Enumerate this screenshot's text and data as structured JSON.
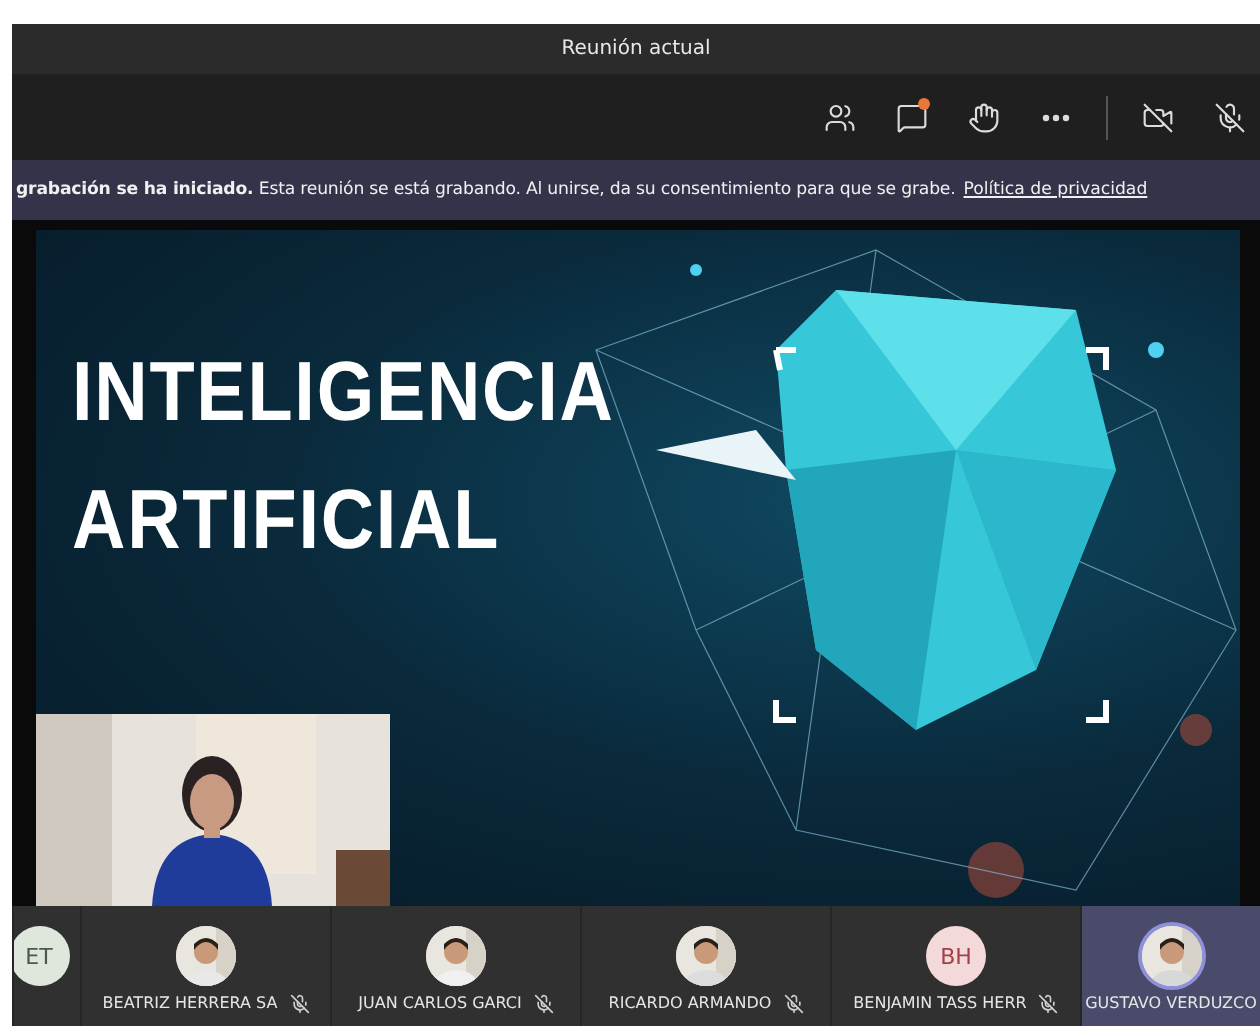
{
  "window": {
    "title": "Reunión actual"
  },
  "toolbar": [
    {
      "kind": "people"
    },
    {
      "kind": "chat",
      "unread": true
    },
    {
      "kind": "hand"
    },
    {
      "kind": "more"
    },
    {
      "kind": "camera-off"
    },
    {
      "kind": "mic-off"
    }
  ],
  "banner": {
    "title": "grabación se ha iniciado.",
    "message": "Esta reunión se está grabando. Al unirse, da su consentimiento para que se grabe.",
    "link": "Política de privacidad"
  },
  "slide": {
    "lines": [
      "INTELIGENCIA",
      "ARTIFICIAL"
    ]
  },
  "participants": [
    {
      "kind": "initials",
      "initials": "ET",
      "speaking": false
    },
    {
      "name": "BEATRIZ HERRERA SA",
      "muted": true,
      "speaking": false
    },
    {
      "name": "JUAN CARLOS GARCI",
      "muted": true,
      "speaking": false
    },
    {
      "name": "RICARDO ARMANDO",
      "muted": true,
      "speaking": false
    },
    {
      "kind": "initials",
      "initials": "BH",
      "name": "BENJAMIN TASS HERR",
      "muted": true,
      "speaking": false
    },
    {
      "name": "GUSTAVO VERDUZCO",
      "muted": false,
      "speaking": true
    }
  ]
}
